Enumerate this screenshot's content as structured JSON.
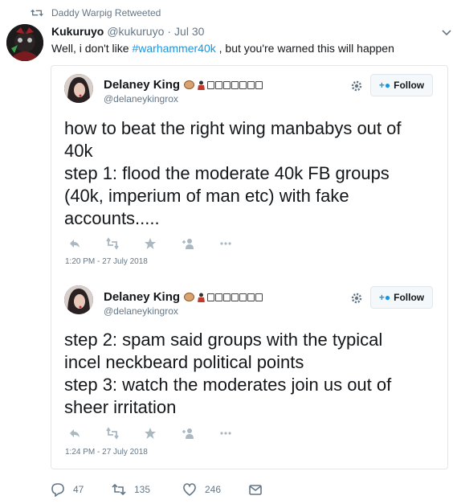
{
  "retweet_bar": {
    "label": "Daddy Warpig Retweeted"
  },
  "tweet": {
    "author_name": "Kukuruyo",
    "author_handle": "@kukuruyo",
    "separator": "·",
    "date": "Jul 30",
    "text_before": "Well, i don't like ",
    "hashtag": "#warhammer40k",
    "text_after": " , but you're warned this will happen"
  },
  "quoted_tweets": [
    {
      "author_name": "Delaney King",
      "author_handle": "@delaneykingrox",
      "follow_label": "Follow",
      "lines": [
        "how to beat the right wing manbabys out of",
        "40k",
        "step 1: flood the moderate 40k FB groups",
        "(40k, imperium of man etc) with fake",
        "accounts....."
      ],
      "timestamp": "1:20 PM - 27 July 2018"
    },
    {
      "author_name": "Delaney King",
      "author_handle": "@delaneykingrox",
      "follow_label": "Follow",
      "lines": [
        "step 2: spam said groups with the typical",
        "incel neckbeard political points",
        "step 3: watch the moderates join us out of",
        "sheer irritation"
      ],
      "timestamp": "1:24 PM - 27 July 2018"
    }
  ],
  "footer": {
    "replies": "47",
    "retweets": "135",
    "likes": "246"
  },
  "colors": {
    "link": "#1b95e0",
    "secondary_text": "#657786",
    "border": "#e1e8ed",
    "icon_gray": "#aab8c2"
  },
  "icons": [
    "retweet-icon",
    "chevron-down-icon",
    "settings-gear-icon",
    "follow-person-icon",
    "reply-icon",
    "like-star-icon",
    "add-person-icon",
    "more-icon",
    "message-icon",
    "heart-icon"
  ]
}
